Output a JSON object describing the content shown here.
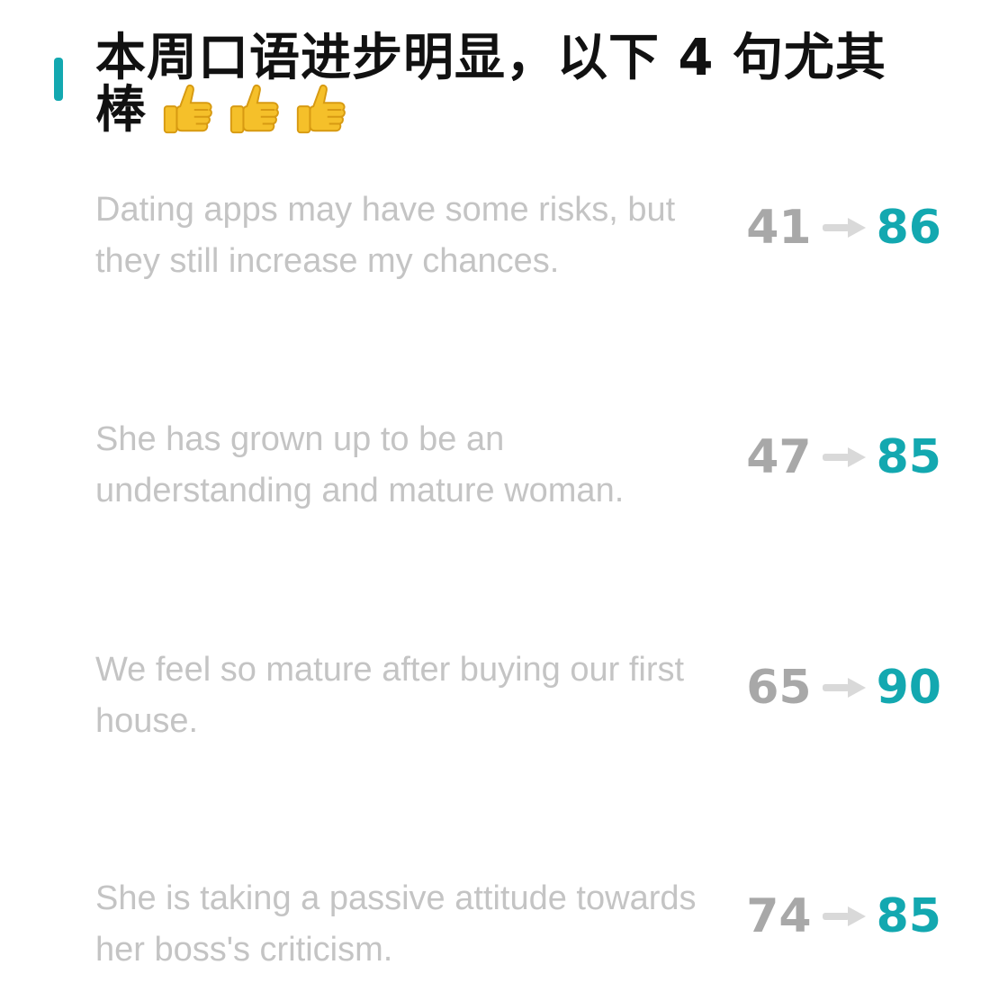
{
  "header": {
    "title": "本周口语进步明显，以下 4 句尤其棒",
    "thumbs_icons": [
      "thumbs-up-icon",
      "thumbs-up-icon",
      "thumbs-up-icon"
    ]
  },
  "colors": {
    "accent": "#13a8b0",
    "sentence_text": "#c4c4c4",
    "old_score": "#a8a8a8",
    "arrow": "#d9d9d9",
    "thumb": "#f5c02a"
  },
  "sentences": [
    {
      "text": "Dating apps may have some risks, but they still increase my chances.",
      "old_score": "41",
      "new_score": "86"
    },
    {
      "text": "She has grown up to be an understanding and mature woman.",
      "old_score": "47",
      "new_score": "85"
    },
    {
      "text": "We feel so mature after buying our first house.",
      "old_score": "65",
      "new_score": "90"
    },
    {
      "text": "She is taking a passive attitude towards her boss's criticism.",
      "old_score": "74",
      "new_score": "85"
    }
  ]
}
